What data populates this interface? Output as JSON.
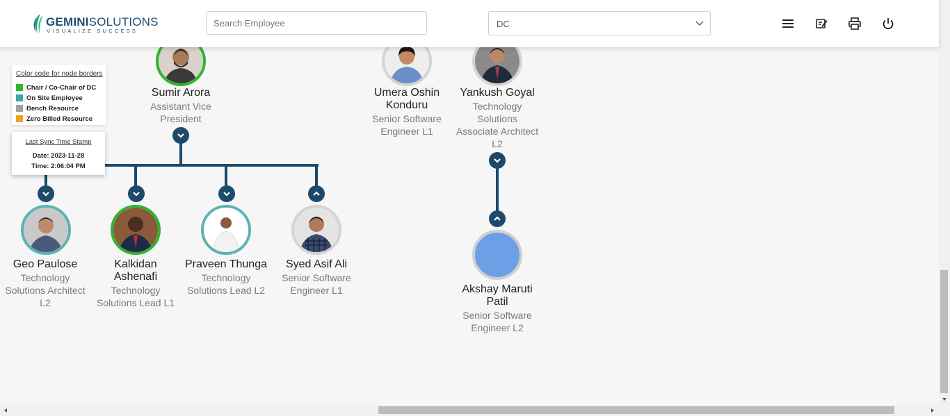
{
  "header": {
    "logo_brand_bold": "GEMINI",
    "logo_brand_rest": "SOLUTIONS",
    "logo_tagline": "VISUALIZE SUCCESS",
    "search_placeholder": "Search Employee",
    "department_selected": "DC",
    "icons": [
      "menu-icon",
      "edit-note-icon",
      "print-icon",
      "power-icon"
    ]
  },
  "legend": {
    "title": "Color code for node borders",
    "items": [
      {
        "label": "Chair / Co-Chair of DC",
        "color": "#2fb52f"
      },
      {
        "label": "On Site Employee",
        "color": "#3aa5a5"
      },
      {
        "label": "Bench Resource",
        "color": "#a0a0a0"
      },
      {
        "label": "Zero Billed Resource",
        "color": "#f0a020"
      }
    ]
  },
  "sync": {
    "title": "Last Sync Time Stamp",
    "date": "Date: 2023-11-28",
    "time": "Time: 2:06:04 PM"
  },
  "colors": {
    "chair": "#2fb52f",
    "onsite": "#5cb3b3",
    "default": "#cfcfcf",
    "connector": "#1d4a6b",
    "placeholder_avatar": "#6b9fe6"
  },
  "nodes": {
    "sumir": {
      "name": "Sumir Arora",
      "title_1": "Assistant Vice",
      "title_2": "President"
    },
    "umera": {
      "name_1": "Umera Oshin",
      "name_2": "Konduru",
      "title_1": "Senior Software",
      "title_2": "Engineer L1"
    },
    "yankush": {
      "name": "Yankush Goyal",
      "title_1": "Technology",
      "title_2": "Solutions",
      "title_3": "Associate Architect",
      "title_4": "L2"
    },
    "geo": {
      "name": "Geo Paulose",
      "title_1": "Technology",
      "title_2": "Solutions Architect",
      "title_3": "L2"
    },
    "kalkidan": {
      "name_1": "Kalkidan",
      "name_2": "Ashenafi",
      "title_1": "Technology",
      "title_2": "Solutions Lead L1"
    },
    "praveen": {
      "name": "Praveen Thunga",
      "title_1": "Technology",
      "title_2": "Solutions Lead L2"
    },
    "syed": {
      "name": "Syed Asif Ali",
      "title_1": "Senior Software",
      "title_2": "Engineer L1"
    },
    "akshay": {
      "name_1": "Akshay Maruti",
      "name_2": "Patil",
      "title_1": "Senior Software",
      "title_2": "Engineer L2"
    }
  }
}
